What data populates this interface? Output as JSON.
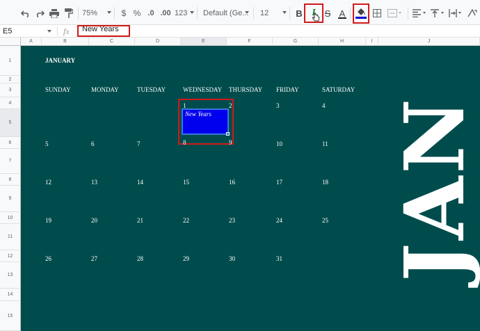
{
  "toolbar": {
    "zoom": "75%",
    "currency": "$",
    "percent": "%",
    "decrease_decimals": ".0",
    "increase_decimals": ".00",
    "more_formats": "123",
    "font_family": "Default (Ge...",
    "font_size": "12",
    "bold": "B",
    "italic": "I",
    "strikethrough": "S",
    "text_color_letter": "A"
  },
  "formula_bar": {
    "cell_ref": "E5",
    "fx": "fx",
    "value": "New Years"
  },
  "columns": [
    "A",
    "B",
    "C",
    "D",
    "E",
    "F",
    "G",
    "H",
    "I",
    "J"
  ],
  "rows": [
    "1",
    "2",
    "3",
    "4",
    "5",
    "6",
    "7",
    "8",
    "9",
    "10",
    "11",
    "12",
    "13",
    "14",
    "15"
  ],
  "calendar": {
    "month_title": "JANUARY",
    "weekdays": [
      "SUNDAY",
      "MONDAY",
      "TUESDAY",
      "WEDNESDAY",
      "THURSDAY",
      "FRIDAY",
      "SATURDAY"
    ],
    "week1": [
      "1",
      "2",
      "3",
      "4"
    ],
    "event": "New Years",
    "week2": [
      "5",
      "6",
      "7",
      "8",
      "9",
      "10",
      "11"
    ],
    "week3": [
      "12",
      "13",
      "14",
      "15",
      "16",
      "17",
      "18"
    ],
    "week4": [
      "19",
      "20",
      "21",
      "22",
      "23",
      "24",
      "25"
    ],
    "week5": [
      "26",
      "27",
      "28",
      "29",
      "30",
      "31"
    ],
    "big_label": "JAN"
  },
  "colors": {
    "sheet_bg": "#004c4c",
    "selection_fill": "#0000ee",
    "highlight_box": "#d11a1a",
    "italic_active": "#188038",
    "fill_color_bar": "#0000cc"
  }
}
